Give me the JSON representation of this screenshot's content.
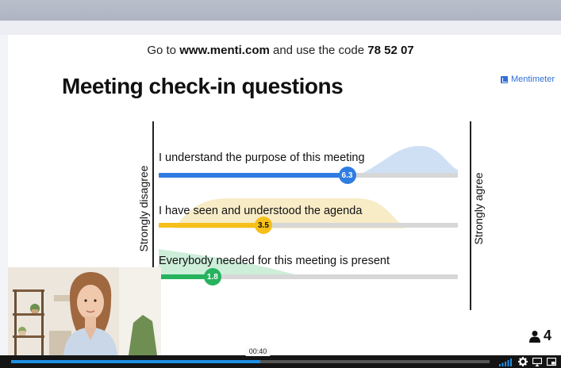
{
  "instructions": {
    "prefix": "Go to ",
    "url": "www.menti.com",
    "middle": " and use the code ",
    "code": "78 52 07"
  },
  "slide": {
    "title": "Meeting check-in questions",
    "brand": "Mentimeter",
    "left_label": "Strongly disagree",
    "right_label": "Strongly agree",
    "scale_max": 10,
    "questions": [
      {
        "text": "I understand the purpose of this meeting",
        "value": 6.3,
        "value_label": "6.3",
        "color": "#2f7de1",
        "dist_color": "#cfe0f5"
      },
      {
        "text": "I have seen and understood the agenda",
        "value": 3.5,
        "value_label": "3.5",
        "color": "#f6bf1a",
        "dist_color": "#f8ecc7"
      },
      {
        "text": "Everybody needed for this meeting is present",
        "value": 1.8,
        "value_label": "1.8",
        "color": "#27b35e",
        "dist_color": "#cdeed9"
      }
    ]
  },
  "participants": {
    "count": "4"
  },
  "player": {
    "time": "00:40",
    "progress": 0.52,
    "accent": "#1e8fe6"
  }
}
